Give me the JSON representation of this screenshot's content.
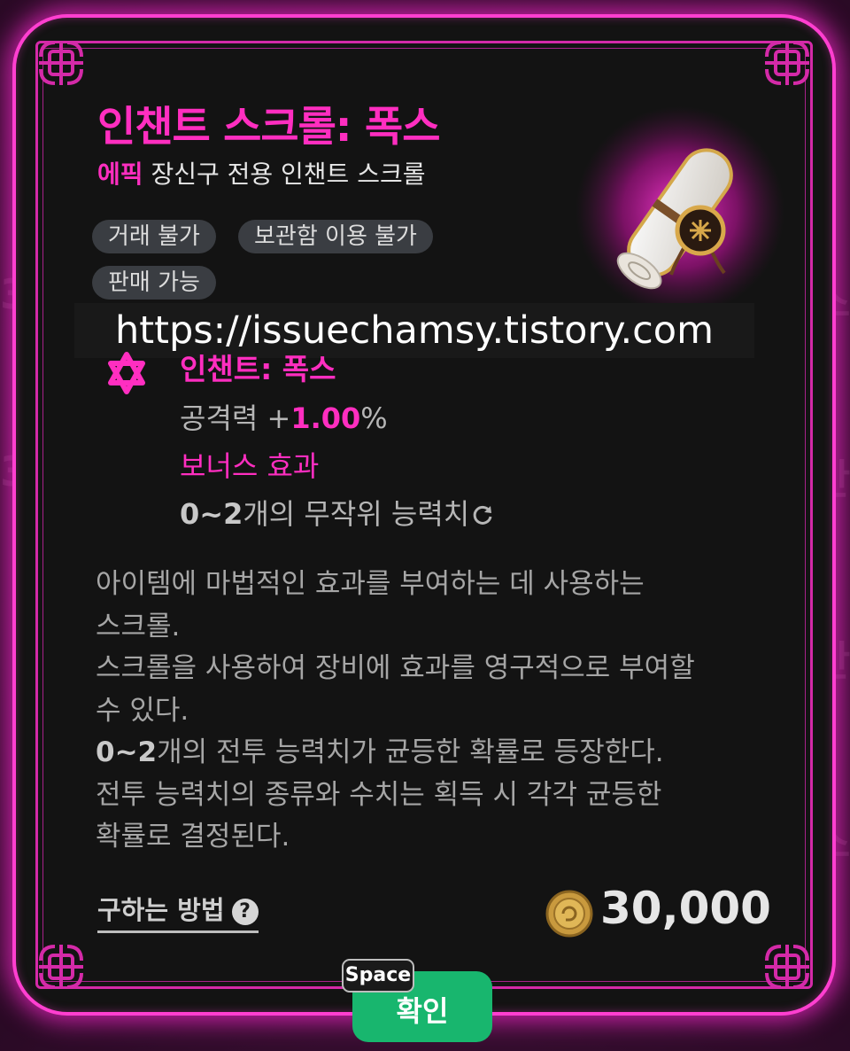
{
  "background_glyphs": [
    "3",
    "3",
    "스",
    "안",
    "안",
    "스"
  ],
  "item": {
    "name": "인챈트 스크롤: 폭스",
    "rarity": "에픽",
    "category": "장신구 전용 인챈트 스크롤",
    "tags": [
      "거래 불가",
      "보관함 이용 불가",
      "판매 가능"
    ]
  },
  "watermark": "https://issuechamsy.tistory.com",
  "enchant": {
    "title": "인챈트: 폭스",
    "stat_label": "공격력 +",
    "stat_value": "1.00",
    "stat_unit": "%",
    "bonus_label": "보너스 효과",
    "random_range": "0~2",
    "random_text": "개의 무작위 능력치"
  },
  "description": {
    "line1": "아이템에 마법적인 효과를 부여하는 데 사용하는",
    "line2": "스크롤.",
    "line3": "스크롤을 사용하여 장비에 효과를 영구적으로 부여할",
    "line4": "수 있다.",
    "line5_bold": "0~2",
    "line5_rest": "개의 전투 능력치가 균등한 확률로 등장한다.",
    "line6": "전투 능력치의 종류와 수치는 획득 시 각각 균등한",
    "line7": "확률로 결정된다."
  },
  "footer": {
    "how_to_get": "구하는 방법",
    "help_symbol": "?",
    "price": "30,000",
    "space_key": "Space",
    "confirm": "확인"
  },
  "colors": {
    "accent": "#ff2ec0",
    "glow": "#ff3fd0",
    "card_bg": "#131313",
    "confirm_bg": "#18b66e"
  },
  "icons": [
    "celtic-knot-icon",
    "enchant-star-icon",
    "refresh-icon",
    "help-icon",
    "gold-coin-icon",
    "scroll-item-image"
  ]
}
